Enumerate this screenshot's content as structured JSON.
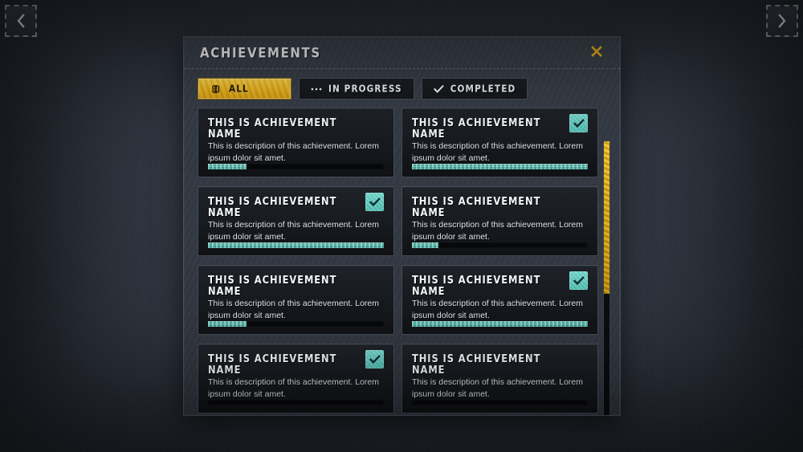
{
  "nav": {
    "prev": {
      "icon": "chevron-left-icon",
      "label": "Previous"
    },
    "next": {
      "icon": "chevron-right-icon",
      "label": "Next"
    }
  },
  "panel": {
    "title": "ACHIEVEMENTS",
    "close": {
      "icon": "close-icon",
      "label": "Close"
    }
  },
  "tabs": [
    {
      "label": "ALL",
      "icon": "infinity-icon",
      "active": true
    },
    {
      "label": "IN PROGRESS",
      "icon": "ellipsis-icon",
      "active": false
    },
    {
      "label": "COMPLETED",
      "icon": "check-icon",
      "active": false
    }
  ],
  "achievements": [
    {
      "title": "THIS IS ACHIEVEMENT NAME",
      "description": "This is description of this achievement. Lorem ipsum dolor sit amet.",
      "progress": 22,
      "completed": false
    },
    {
      "title": "THIS IS ACHIEVEMENT NAME",
      "description": "This is description of this achievement. Lorem ipsum dolor sit amet.",
      "progress": 100,
      "completed": true
    },
    {
      "title": "THIS IS ACHIEVEMENT NAME",
      "description": "This is description of this achievement. Lorem ipsum dolor sit amet.",
      "progress": 100,
      "completed": true
    },
    {
      "title": "THIS IS ACHIEVEMENT NAME",
      "description": "This is description of this achievement. Lorem ipsum dolor sit amet.",
      "progress": 15,
      "completed": false
    },
    {
      "title": "THIS IS ACHIEVEMENT NAME",
      "description": "This is description of this achievement. Lorem ipsum dolor sit amet.",
      "progress": 22,
      "completed": false
    },
    {
      "title": "THIS IS ACHIEVEMENT NAME",
      "description": "This is description of this achievement. Lorem ipsum dolor sit amet.",
      "progress": 100,
      "completed": true
    },
    {
      "title": "THIS IS ACHIEVEMENT NAME",
      "description": "This is description of this achievement. Lorem ipsum dolor sit amet.",
      "progress": 0,
      "completed": true
    },
    {
      "title": "THIS IS ACHIEVEMENT NAME",
      "description": "This is description of this achievement. Lorem ipsum dolor sit amet.",
      "progress": 0,
      "completed": false
    }
  ],
  "scrollbar": {
    "thumb_percent": 50,
    "position_percent": 0
  },
  "colors": {
    "accent_gold": "#f0b81f",
    "accent_teal": "#5cc9c0",
    "panel_bg": "#343a44",
    "card_bg": "#171a1f",
    "page_bg": "#2f353f",
    "text": "#f2f4f7"
  }
}
